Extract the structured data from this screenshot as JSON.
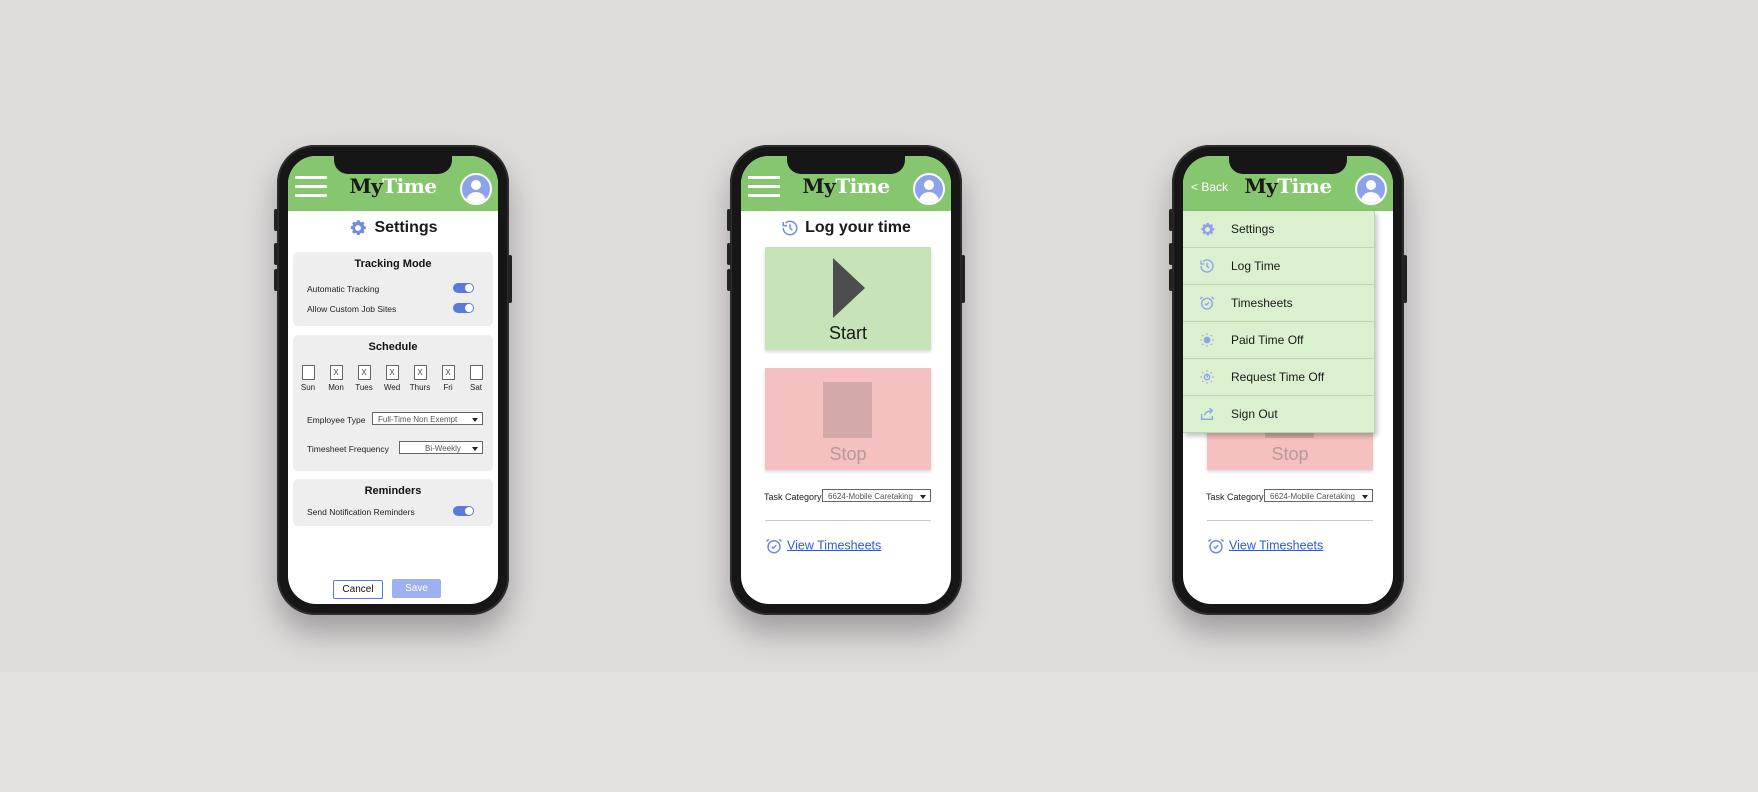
{
  "app": {
    "logo_my": "My",
    "logo_time": "Time"
  },
  "settings": {
    "title": "Settings",
    "tracking_mode": {
      "title": "Tracking Mode",
      "items": [
        {
          "label": "Automatic Tracking",
          "enabled": true
        },
        {
          "label": "Allow Custom Job Sites",
          "enabled": true
        }
      ]
    },
    "schedule": {
      "title": "Schedule",
      "days": [
        {
          "label": "Sun",
          "mark": ""
        },
        {
          "label": "Mon",
          "mark": "X"
        },
        {
          "label": "Tues",
          "mark": "X"
        },
        {
          "label": "Wed",
          "mark": "X"
        },
        {
          "label": "Thurs",
          "mark": "X"
        },
        {
          "label": "Fri",
          "mark": "X"
        },
        {
          "label": "Sat",
          "mark": ""
        }
      ],
      "employee_type_label": "Employee Type",
      "employee_type_value": "Full-Time Non Exempt",
      "timesheet_frequency_label": "Timesheet Frequency",
      "timesheet_frequency_value": "Bi-Weekly"
    },
    "reminders": {
      "title": "Reminders",
      "items": [
        {
          "label": "Send Notification Reminders",
          "enabled": true
        }
      ]
    },
    "cancel_label": "Cancel",
    "save_label": "Save"
  },
  "log_time": {
    "title": "Log your time",
    "start_label": "Start",
    "stop_label": "Stop",
    "task_category_label": "Task Category",
    "task_category_value": "6624-Mobile Caretaking",
    "view_timesheets_label": "View Timesheets"
  },
  "menu_screen": {
    "back_label": "< Back",
    "items": [
      {
        "label": "Settings",
        "icon": "gear-icon"
      },
      {
        "label": "Log Time",
        "icon": "history-icon"
      },
      {
        "label": "Timesheets",
        "icon": "alarm-check-icon"
      },
      {
        "label": "Paid Time Off",
        "icon": "sun-icon"
      },
      {
        "label": "Request Time Off",
        "icon": "sun-question-icon"
      },
      {
        "label": "Sign Out",
        "icon": "share-icon"
      }
    ]
  },
  "colors": {
    "appbar_green": "#86c66f",
    "start_green": "#c6e4b8",
    "stop_red": "#f4c0c0",
    "accent_blue": "#5b7bd8",
    "menu_green": "#daf0cf"
  }
}
